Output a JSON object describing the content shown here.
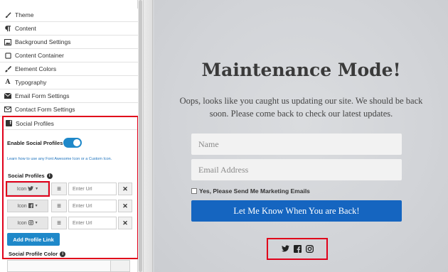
{
  "panel": {
    "menu": [
      {
        "label": "Theme",
        "icon": "brush-icon"
      },
      {
        "label": "Content",
        "icon": "paragraph-icon"
      },
      {
        "label": "Background Settings",
        "icon": "image-icon"
      },
      {
        "label": "Content Container",
        "icon": "square-icon"
      },
      {
        "label": "Element Colors",
        "icon": "paint-brush-icon"
      },
      {
        "label": "Typography",
        "icon": "font-icon"
      },
      {
        "label": "Email Form Settings",
        "icon": "envelope-icon"
      },
      {
        "label": "Contact Form Settings",
        "icon": "envelope-open-icon"
      }
    ],
    "social_section": {
      "title": "Social Profiles",
      "enable_label": "Enable Social Profiles",
      "enabled": true,
      "learn_link": "Learn how to use any Font Awesome Icon or a Custom Icon.",
      "profiles_label": "Social Profiles",
      "icon_text": "Icon",
      "rows": [
        {
          "icon": "twitter-icon",
          "glyph": "❧",
          "url_placeholder": "Enter Url"
        },
        {
          "icon": "facebook-icon",
          "glyph": "f",
          "url_placeholder": "Enter Url"
        },
        {
          "icon": "instagram-icon",
          "glyph": "◎",
          "url_placeholder": "Enter Url"
        }
      ],
      "add_button": "Add Profile Link",
      "color_label": "Social Profile Color"
    }
  },
  "preview": {
    "title": "Maintenance Mode!",
    "message": "Oops, looks like you caught us updating our site. We should be back soon. Please come back to check our latest updates.",
    "name_placeholder": "Name",
    "email_placeholder": "Email Address",
    "checkbox_label": "Yes, Please Send Me Marketing Emails",
    "button_label": "Let Me Know When You are Back!",
    "social_icons": [
      "twitter-icon",
      "facebook-icon",
      "instagram-icon"
    ]
  },
  "colors": {
    "accent": "#1e88c9",
    "button": "#1565c0",
    "highlight": "#e0001a"
  }
}
